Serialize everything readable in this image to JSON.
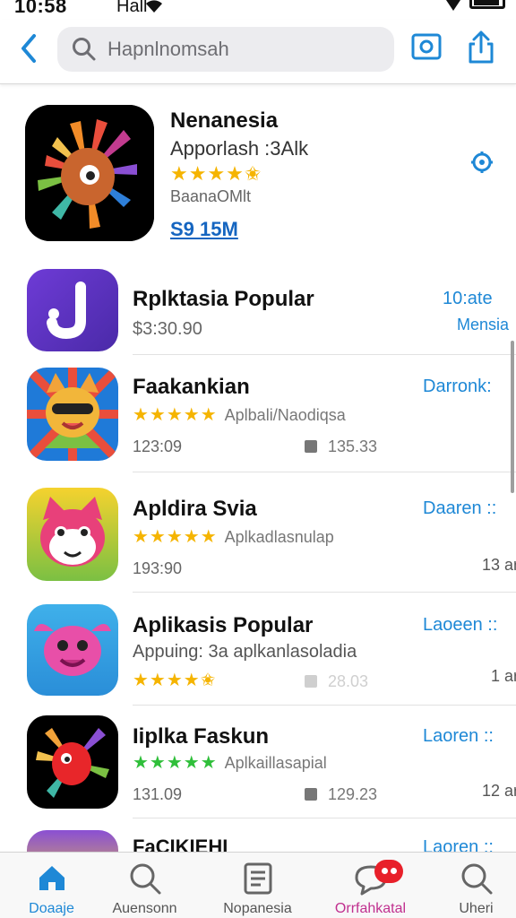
{
  "status_bar": {
    "time": "10:58",
    "signal": "Hall",
    "wifi_icon": "wifi-icon",
    "battery_icon": "battery-icon"
  },
  "header": {
    "search_placeholder": "Hapnlnomsah",
    "icons": [
      "chevron-left-icon",
      "search-icon",
      "camera-square-icon",
      "share-icon"
    ]
  },
  "featured": {
    "title": "Nenanesia",
    "subtitle": "Apporlash :3Alk",
    "stars": "★★★★✬",
    "developer": "BaanaOMlt",
    "price": "S9 15M"
  },
  "apps": [
    {
      "title": "Rplktasia Popular",
      "subtitle": "$3:30.90",
      "right_top": "10:ate",
      "right_bottom": "Mensia"
    },
    {
      "title": "Faakankian",
      "stars": "★★★★★",
      "category": "Aplbali/Naodiqsa",
      "date": "123:09",
      "size": "135.33",
      "action": "Darronk:"
    },
    {
      "title": "Apldira Svia",
      "stars": "★★★★★",
      "category": "Aplkadlasnulap",
      "date": "193:90",
      "action": "Daaren ::",
      "right_bottom": "13 ar"
    },
    {
      "title": "Aplikasis Popular",
      "subtitle": "Appuing: 3a aplkanlasoladia",
      "stars": "★★★★✬",
      "size": "28.03",
      "action": "Laoeen ::",
      "right_bottom": "1 ar"
    },
    {
      "title": "Iiplka Faskun",
      "stars": "★★★★★",
      "category": "Aplkaillasapial",
      "date": "131.09",
      "size": "129.23",
      "action": "Laoren ::",
      "right_bottom": "12 ar"
    },
    {
      "title": "FaCIKIEHI",
      "action": "Laoren ::"
    }
  ],
  "tabs": [
    {
      "label": "Doaaje",
      "icon": "home-icon",
      "active": true
    },
    {
      "label": "Auensonn",
      "icon": "search-icon",
      "active": false
    },
    {
      "label": "Nopanesia",
      "icon": "document-icon",
      "active": false
    },
    {
      "label": "Orrfahkatal",
      "icon": "chat-icon",
      "active": false,
      "badge": "..."
    },
    {
      "label": "Uheri",
      "icon": "search-icon",
      "active": false
    }
  ],
  "colors": {
    "accent": "#1e88d6",
    "star": "#f5b400",
    "star_green": "#2fbf3a",
    "badge": "#e8202a"
  }
}
